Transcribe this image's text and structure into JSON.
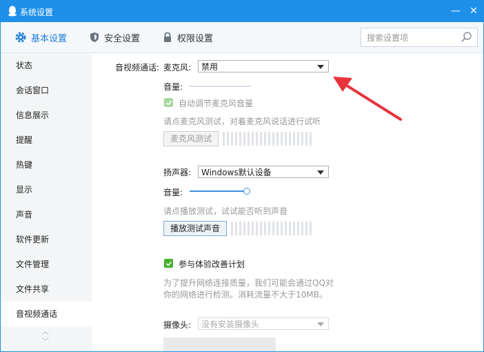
{
  "window": {
    "title": "系统设置",
    "minimize": "—",
    "close": "✕"
  },
  "toolbar": {
    "tabs": [
      {
        "label": "基本设置",
        "icon": "gear-icon"
      },
      {
        "label": "安全设置",
        "icon": "shield-icon"
      },
      {
        "label": "权限设置",
        "icon": "lock-icon"
      }
    ],
    "search_placeholder": "搜索设置项"
  },
  "sidebar": {
    "items": [
      "状态",
      "会话窗口",
      "信息展示",
      "提醒",
      "热键",
      "显示",
      "声音",
      "软件更新",
      "文件管理",
      "文件共享",
      "音视频通话"
    ],
    "active_index": 10
  },
  "av": {
    "section_label": "音视频通话:",
    "mic": {
      "label": "麦克风:",
      "value": "禁用",
      "volume_label": "音量:",
      "auto_adjust_label": "自动调节麦克风音量",
      "auto_adjust_checked": true,
      "hint": "请点麦克风测试，对着麦克风说话进行试听",
      "test_button": "麦克风测试"
    },
    "speaker": {
      "label": "扬声器:",
      "value": "Windows默认设备",
      "volume_label": "音量:",
      "volume_level": 1.0,
      "hint": "请点播放测试，试试能否听到声音",
      "test_button": "播放测试声音"
    },
    "improve": {
      "label": "参与体验改善计划",
      "checked": true,
      "desc_line1": "为了提升网络连接质量，我们可能会通过QQ对",
      "desc_line2": "你的网络进行检测。消耗流量不大于10MB。"
    },
    "camera": {
      "label": "摄像头:",
      "value": "没有安装摄像头"
    }
  },
  "colors": {
    "accent": "#1f90ea",
    "check": "#46b02f",
    "arrow": "#e8323c"
  }
}
